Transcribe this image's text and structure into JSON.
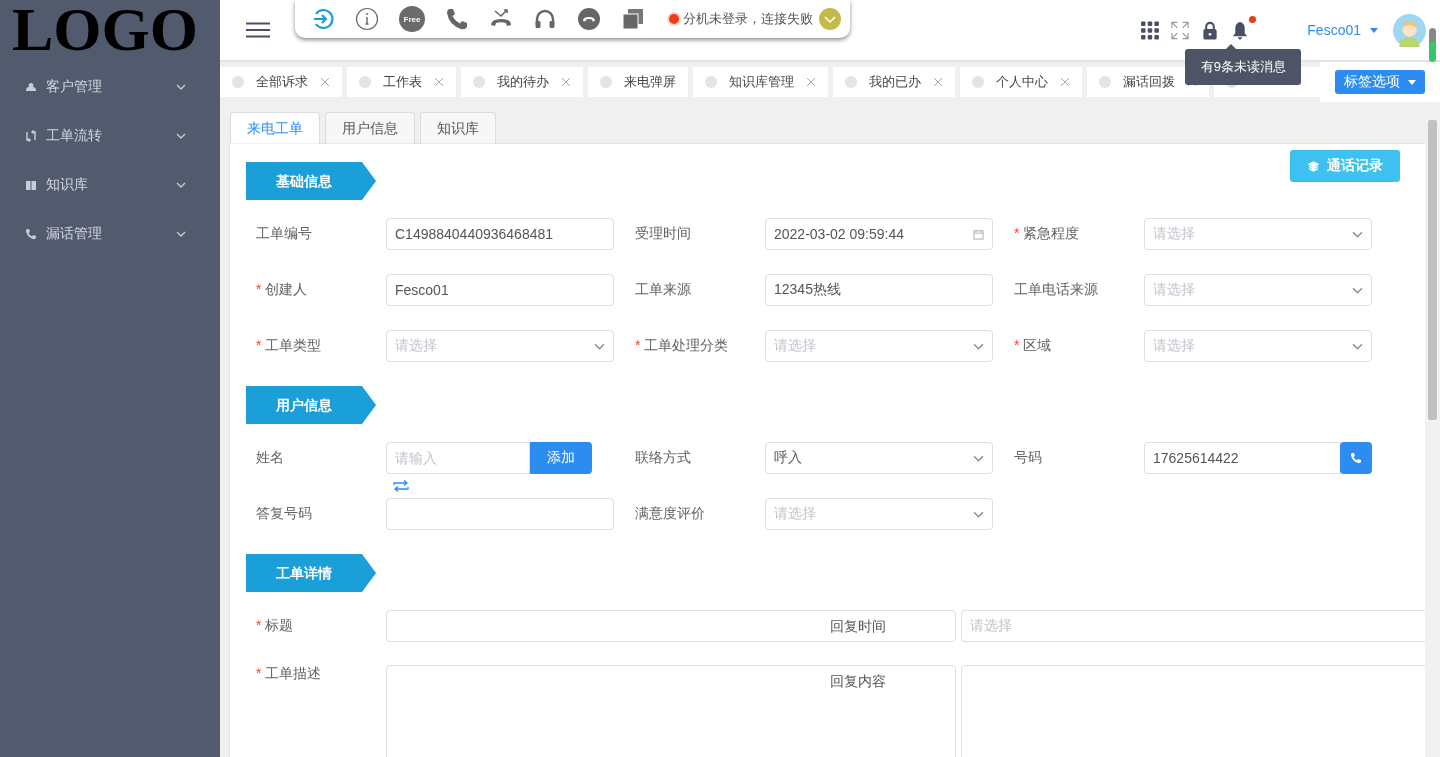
{
  "logo": "LOGO",
  "sidebar": {
    "items": [
      {
        "label": "客户管理",
        "expanded": false
      },
      {
        "label": "工单流转",
        "expanded": false
      },
      {
        "label": "知识库",
        "expanded": false
      },
      {
        "label": "漏话管理",
        "expanded": false
      }
    ]
  },
  "softphone": {
    "free_badge": "Free",
    "connected": false,
    "status_text": "分机未登录，连接失败"
  },
  "notifications": {
    "unread": true,
    "tooltip": "有9条未读消息"
  },
  "user": {
    "name": "Fesco01"
  },
  "page_tabs": [
    {
      "label": "全部诉求",
      "closable": true
    },
    {
      "label": "工作表",
      "closable": true
    },
    {
      "label": "我的待办",
      "closable": true
    },
    {
      "label": "来电弹屏",
      "closable": false
    },
    {
      "label": "知识库管理",
      "closable": true
    },
    {
      "label": "我的已办",
      "closable": true
    },
    {
      "label": "个人中心",
      "closable": true
    },
    {
      "label": "漏话回拨",
      "closable": true
    }
  ],
  "tab_options_button": "标签选项",
  "form_tabs": [
    {
      "label": "来电工单",
      "selected": true
    },
    {
      "label": "用户信息",
      "selected": false
    },
    {
      "label": "知识库",
      "selected": false
    }
  ],
  "call_log_button": "通话记录",
  "required_mark": "*",
  "sections": [
    {
      "title": "基础信息",
      "fields": [
        {
          "label": "工单编号",
          "required": false,
          "kind": "text",
          "value": "C1498840440936468481"
        },
        {
          "label": "受理时间",
          "required": false,
          "kind": "date",
          "value": "2022-03-02 09:59:44"
        },
        {
          "label": "紧急程度",
          "required": true,
          "kind": "select",
          "placeholder": "请选择"
        },
        {
          "label": "创建人",
          "required": true,
          "kind": "text",
          "value": "Fesco01"
        },
        {
          "label": "工单来源",
          "required": false,
          "kind": "text",
          "value": "12345热线"
        },
        {
          "label": "工单电话来源",
          "required": false,
          "kind": "select",
          "placeholder": "请选择"
        },
        {
          "label": "工单类型",
          "required": true,
          "kind": "select",
          "placeholder": "请选择"
        },
        {
          "label": "工单处理分类",
          "required": true,
          "kind": "select",
          "placeholder": "请选择"
        },
        {
          "label": "区域",
          "required": true,
          "kind": "select",
          "placeholder": "请选择"
        }
      ]
    },
    {
      "title": "用户信息",
      "fields": [
        {
          "label": "姓名",
          "required": false,
          "kind": "input_add",
          "placeholder": "请输入",
          "button": "添加"
        },
        {
          "label": "联络方式",
          "required": false,
          "kind": "select",
          "value": "呼入"
        },
        {
          "label": "号码",
          "required": false,
          "kind": "input_call",
          "value": "17625614422"
        },
        {
          "label": "答复号码",
          "required": false,
          "kind": "text"
        },
        {
          "label": "满意度评价",
          "required": false,
          "kind": "select",
          "placeholder": "请选择"
        }
      ]
    },
    {
      "title": "工单详情",
      "fields": [
        {
          "label": "标题",
          "required": true,
          "kind": "split_input",
          "inner_label": "回复时间",
          "side_placeholder": "请选择"
        },
        {
          "label": "工单描述",
          "required": true,
          "kind": "split_textarea",
          "inner_label": "回复内容"
        }
      ]
    }
  ]
}
